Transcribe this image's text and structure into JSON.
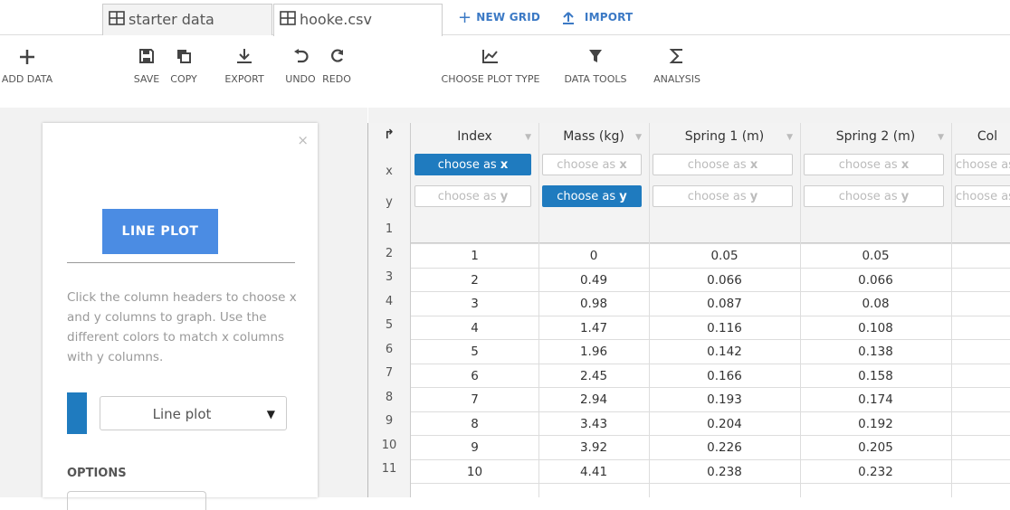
{
  "tabs": [
    {
      "label": "starter data",
      "active": false
    },
    {
      "label": "hooke.csv",
      "active": true
    }
  ],
  "top_actions": {
    "new_grid": "NEW GRID",
    "import": "IMPORT"
  },
  "toolbar": {
    "add_data": "ADD DATA",
    "save": "SAVE",
    "copy": "COPY",
    "export": "EXPORT",
    "undo": "UNDO",
    "redo": "REDO",
    "choose_plot_type": "CHOOSE PLOT TYPE",
    "data_tools": "DATA TOOLS",
    "analysis": "ANALYSIS"
  },
  "panel": {
    "close": "×",
    "plot_button": "LINE PLOT",
    "help_text": "Click the column headers to choose x and y columns to graph. Use the different colors to match x columns with y columns.",
    "series_select": "Line plot",
    "options_label": "OPTIONS",
    "series_color": "#1f7bbf"
  },
  "grid": {
    "corner_icon": "↱",
    "axis_x": "x",
    "axis_y": "y",
    "choose_x_prefix": "choose as ",
    "choose_x_letter": "x",
    "choose_y_prefix": "choose as ",
    "choose_y_letter": "y",
    "columns": [
      {
        "name": "Index",
        "x_selected": true,
        "y_selected": false
      },
      {
        "name": "Mass (kg)",
        "x_selected": false,
        "y_selected": true
      },
      {
        "name": "Spring 1 (m)",
        "x_selected": false,
        "y_selected": false
      },
      {
        "name": "Spring 2 (m)",
        "x_selected": false,
        "y_selected": false
      },
      {
        "name": "Col",
        "x_selected": false,
        "y_selected": false
      }
    ],
    "row_numbers": [
      "1",
      "2",
      "3",
      "4",
      "5",
      "6",
      "7",
      "8",
      "9",
      "10",
      "11"
    ],
    "rows": [
      [
        "1",
        "0",
        "0.05",
        "0.05"
      ],
      [
        "2",
        "0.49",
        "0.066",
        "0.066"
      ],
      [
        "3",
        "0.98",
        "0.087",
        "0.08"
      ],
      [
        "4",
        "1.47",
        "0.116",
        "0.108"
      ],
      [
        "5",
        "1.96",
        "0.142",
        "0.138"
      ],
      [
        "6",
        "2.45",
        "0.166",
        "0.158"
      ],
      [
        "7",
        "2.94",
        "0.193",
        "0.174"
      ],
      [
        "8",
        "3.43",
        "0.204",
        "0.192"
      ],
      [
        "9",
        "3.92",
        "0.226",
        "0.205"
      ],
      [
        "10",
        "4.41",
        "0.238",
        "0.232"
      ]
    ],
    "selected_color": "#1f7bbf"
  }
}
